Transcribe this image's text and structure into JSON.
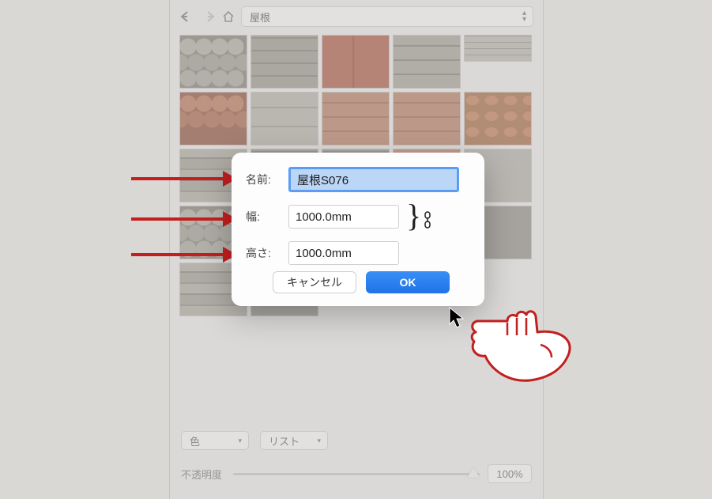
{
  "nav": {
    "category": "屋根"
  },
  "controls": {
    "color_label": "色",
    "view_label": "リスト",
    "opacity_label": "不透明度",
    "opacity_value": "100%"
  },
  "dialog": {
    "name_label": "名前:",
    "name_value": "屋根S076",
    "width_label": "幅:",
    "width_value": "1000.0mm",
    "height_label": "高さ:",
    "height_value": "1000.0mm",
    "cancel": "キャンセル",
    "ok": "OK"
  }
}
